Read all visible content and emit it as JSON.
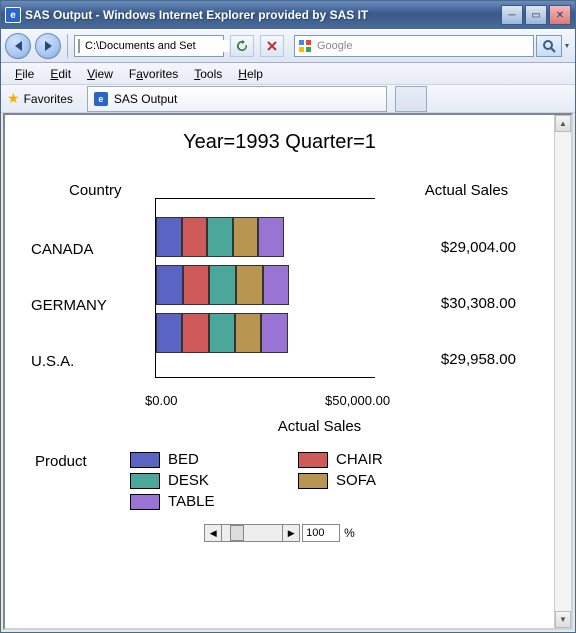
{
  "window": {
    "title": "SAS Output - Windows Internet Explorer provided by SAS IT"
  },
  "nav": {
    "address": "C:\\Documents and Set",
    "search_placeholder": "Google"
  },
  "menus": {
    "file": "File",
    "edit": "Edit",
    "view": "View",
    "favorites": "Favorites",
    "tools": "Tools",
    "help": "Help"
  },
  "favbar": {
    "label": "Favorites",
    "tab": "SAS Output"
  },
  "zoom": {
    "value": "100",
    "pct": "%"
  },
  "chart_data": {
    "type": "bar",
    "title": "Year=1993 Quarter=1",
    "y_axis_label": "Country",
    "x_axis_label": "Actual Sales",
    "value_header": "Actual Sales",
    "legend_header": "Product",
    "xticks": [
      "$0.00",
      "$50,000.00"
    ],
    "categories": [
      "CANADA",
      "GERMANY",
      "U.S.A."
    ],
    "totals_display": [
      "$29,004.00",
      "$30,308.00",
      "$29,958.00"
    ],
    "totals": [
      29004.0,
      30308.0,
      29958.0
    ],
    "series": [
      {
        "name": "BED",
        "color": "#5a64c2",
        "values": [
          5801,
          6062,
          5992
        ]
      },
      {
        "name": "CHAIR",
        "color": "#cf5a5a",
        "values": [
          5801,
          6062,
          5992
        ]
      },
      {
        "name": "DESK",
        "color": "#4aa79a",
        "values": [
          5801,
          6062,
          5992
        ]
      },
      {
        "name": "SOFA",
        "color": "#b89550",
        "values": [
          5801,
          6062,
          5992
        ]
      },
      {
        "name": "TABLE",
        "color": "#9a74d4",
        "values": [
          5800,
          6060,
          5990
        ]
      }
    ],
    "xlim": [
      0,
      50000
    ]
  }
}
